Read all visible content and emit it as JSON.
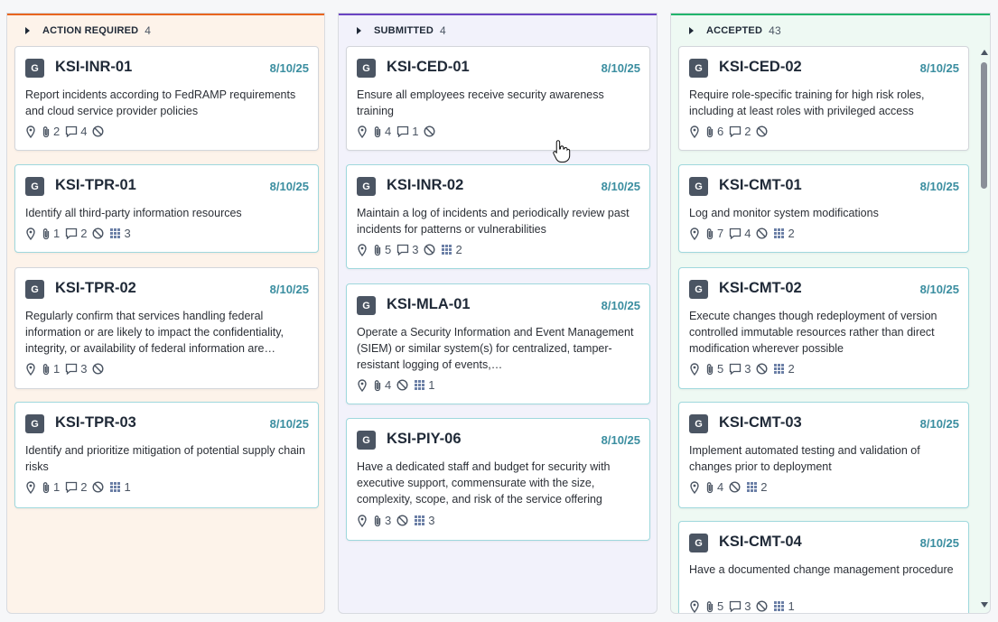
{
  "columns": [
    {
      "title": "ACTION REQUIRED",
      "count": "4",
      "cards": [
        {
          "id": "KSI-INR-01",
          "date": "8/10/25",
          "avatar": "G",
          "desc": "Report incidents according to FedRAMP requirements and cloud service provider policies",
          "attachments": "2",
          "comments": "4",
          "grid": ""
        },
        {
          "id": "KSI-TPR-01",
          "date": "8/10/25",
          "avatar": "G",
          "desc": "Identify all third-party information resources",
          "attachments": "1",
          "comments": "2",
          "grid": "3"
        },
        {
          "id": "KSI-TPR-02",
          "date": "8/10/25",
          "avatar": "G",
          "desc": "Regularly confirm that services handling federal information or are likely to impact the confidentiality, integrity, or availability of federal information are…",
          "attachments": "1",
          "comments": "3",
          "grid": ""
        },
        {
          "id": "KSI-TPR-03",
          "date": "8/10/25",
          "avatar": "G",
          "desc": "Identify and prioritize mitigation of potential supply chain risks",
          "attachments": "1",
          "comments": "2",
          "grid": "1"
        }
      ]
    },
    {
      "title": "SUBMITTED",
      "count": "4",
      "cards": [
        {
          "id": "KSI-CED-01",
          "date": "8/10/25",
          "avatar": "G",
          "desc": "Ensure all employees receive security awareness training",
          "attachments": "4",
          "comments": "1",
          "grid": ""
        },
        {
          "id": "KSI-INR-02",
          "date": "8/10/25",
          "avatar": "G",
          "desc": "Maintain a log of incidents and periodically review past incidents for patterns or vulnerabilities",
          "attachments": "5",
          "comments": "3",
          "grid": "2"
        },
        {
          "id": "KSI-MLA-01",
          "date": "8/10/25",
          "avatar": "G",
          "desc": "Operate a Security Information and Event Management (SIEM) or similar system(s) for centralized, tamper-resistant logging of events,…",
          "attachments": "4",
          "comments": "",
          "grid": "1"
        },
        {
          "id": "KSI-PIY-06",
          "date": "8/10/25",
          "avatar": "G",
          "desc": "Have a dedicated staff and budget for security with executive support, commensurate with the size, complexity, scope, and risk of the service offering",
          "attachments": "3",
          "comments": "",
          "grid": "3"
        }
      ]
    },
    {
      "title": "ACCEPTED",
      "count": "43",
      "cards": [
        {
          "id": "KSI-CED-02",
          "date": "8/10/25",
          "avatar": "G",
          "desc": "Require role-specific training for high risk roles, including at least roles with privileged access",
          "attachments": "6",
          "comments": "2",
          "grid": ""
        },
        {
          "id": "KSI-CMT-01",
          "date": "8/10/25",
          "avatar": "G",
          "desc": "Log and monitor system modifications",
          "attachments": "7",
          "comments": "4",
          "grid": "2"
        },
        {
          "id": "KSI-CMT-02",
          "date": "8/10/25",
          "avatar": "G",
          "desc": "Execute changes though redeployment of version controlled immutable resources rather than direct modification wherever possible",
          "attachments": "5",
          "comments": "3",
          "grid": "2"
        },
        {
          "id": "KSI-CMT-03",
          "date": "8/10/25",
          "avatar": "G",
          "desc": "Implement automated testing and validation of changes prior to deployment",
          "attachments": "4",
          "comments": "",
          "grid": "2"
        },
        {
          "id": "KSI-CMT-04",
          "date": "8/10/25",
          "avatar": "G",
          "desc": "Have a documented change management procedure",
          "attachments": "5",
          "comments": "3",
          "grid": "1"
        }
      ]
    }
  ],
  "colors": {
    "action": "#e8651f",
    "submitted": "#6a43c2",
    "accepted": "#21b56c",
    "date": "#3b8ea0"
  },
  "icons": [
    "caret-right-icon",
    "location-pin-icon",
    "paperclip-icon",
    "comment-icon",
    "blocked-icon",
    "grid-icon",
    "hand-cursor-icon"
  ]
}
